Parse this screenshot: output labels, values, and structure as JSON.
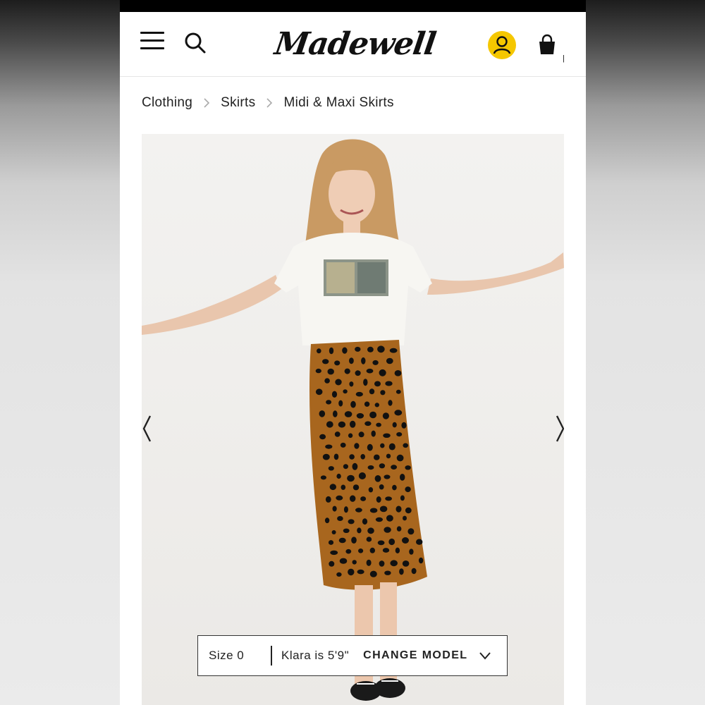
{
  "brand": {
    "logo_text": "Madewell"
  },
  "header": {
    "menu_icon": "hamburger-menu-icon",
    "search_icon": "search-icon",
    "account_icon": "user-account-icon",
    "bag_icon": "shopping-bag-icon",
    "bag_count": "|",
    "account_color": "#f5c700"
  },
  "breadcrumb": {
    "items": [
      {
        "label": "Clothing"
      },
      {
        "label": "Skirts"
      },
      {
        "label": "Midi & Maxi Skirts"
      }
    ]
  },
  "gallery": {
    "prev_icon": "chevron-left-icon",
    "next_icon": "chevron-right-icon"
  },
  "model_bar": {
    "size": "Size 0",
    "model_info": "Klara is 5'9\"",
    "change_model_label": "CHANGE MODEL",
    "dropdown_icon": "chevron-down-icon"
  },
  "colors": {
    "skirt": "#a8661e",
    "spots": "#111111",
    "background": "#f2f1ef"
  }
}
